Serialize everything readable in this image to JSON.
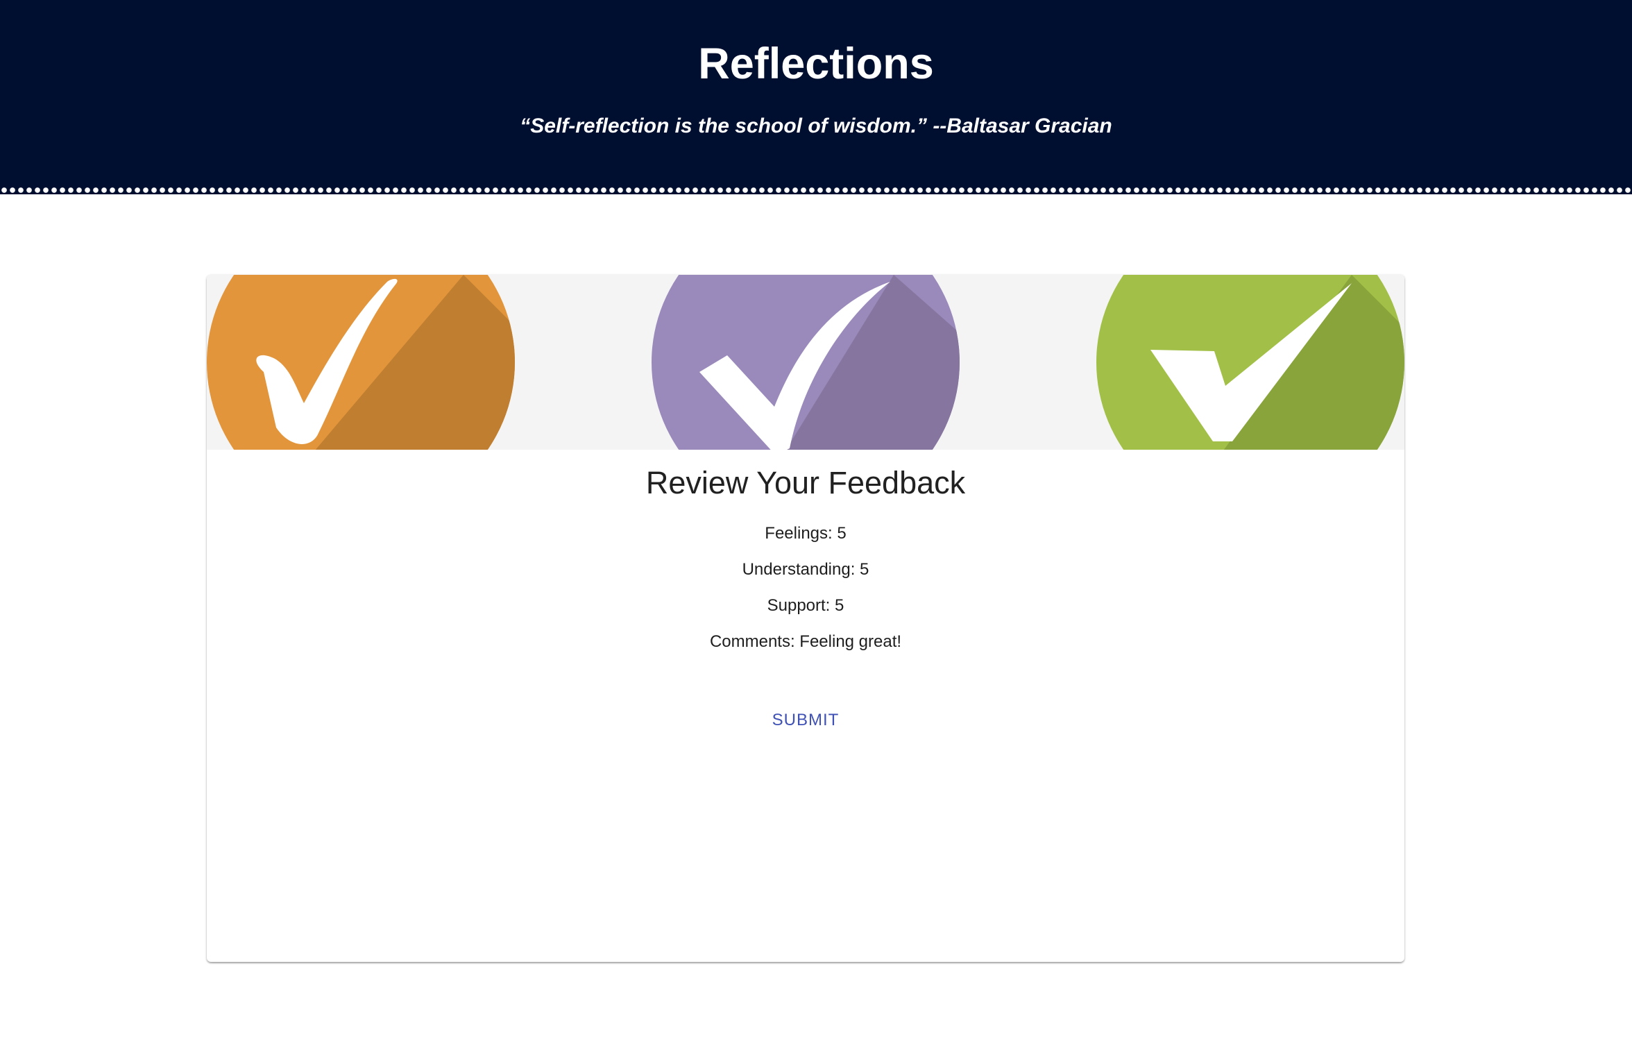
{
  "header": {
    "title": "Reflections",
    "quote": "“Self-reflection is the school of wisdom.” --Baltasar Gracian",
    "background_color": "#000e30"
  },
  "banner": {
    "icons": [
      {
        "name": "orange-checkmark-icon",
        "color": "#e2953a"
      },
      {
        "name": "purple-checkmark-icon",
        "color": "#9a8abb"
      },
      {
        "name": "green-checkmark-icon",
        "color": "#a2c047"
      }
    ]
  },
  "review": {
    "title": "Review Your Feedback",
    "feelings": "Feelings: 5",
    "understanding": "Understanding: 5",
    "support": "Support: 5",
    "comments": "Comments: Feeling great!"
  },
  "actions": {
    "submit_label": "SUBMIT",
    "submit_color": "#3f51b5"
  }
}
